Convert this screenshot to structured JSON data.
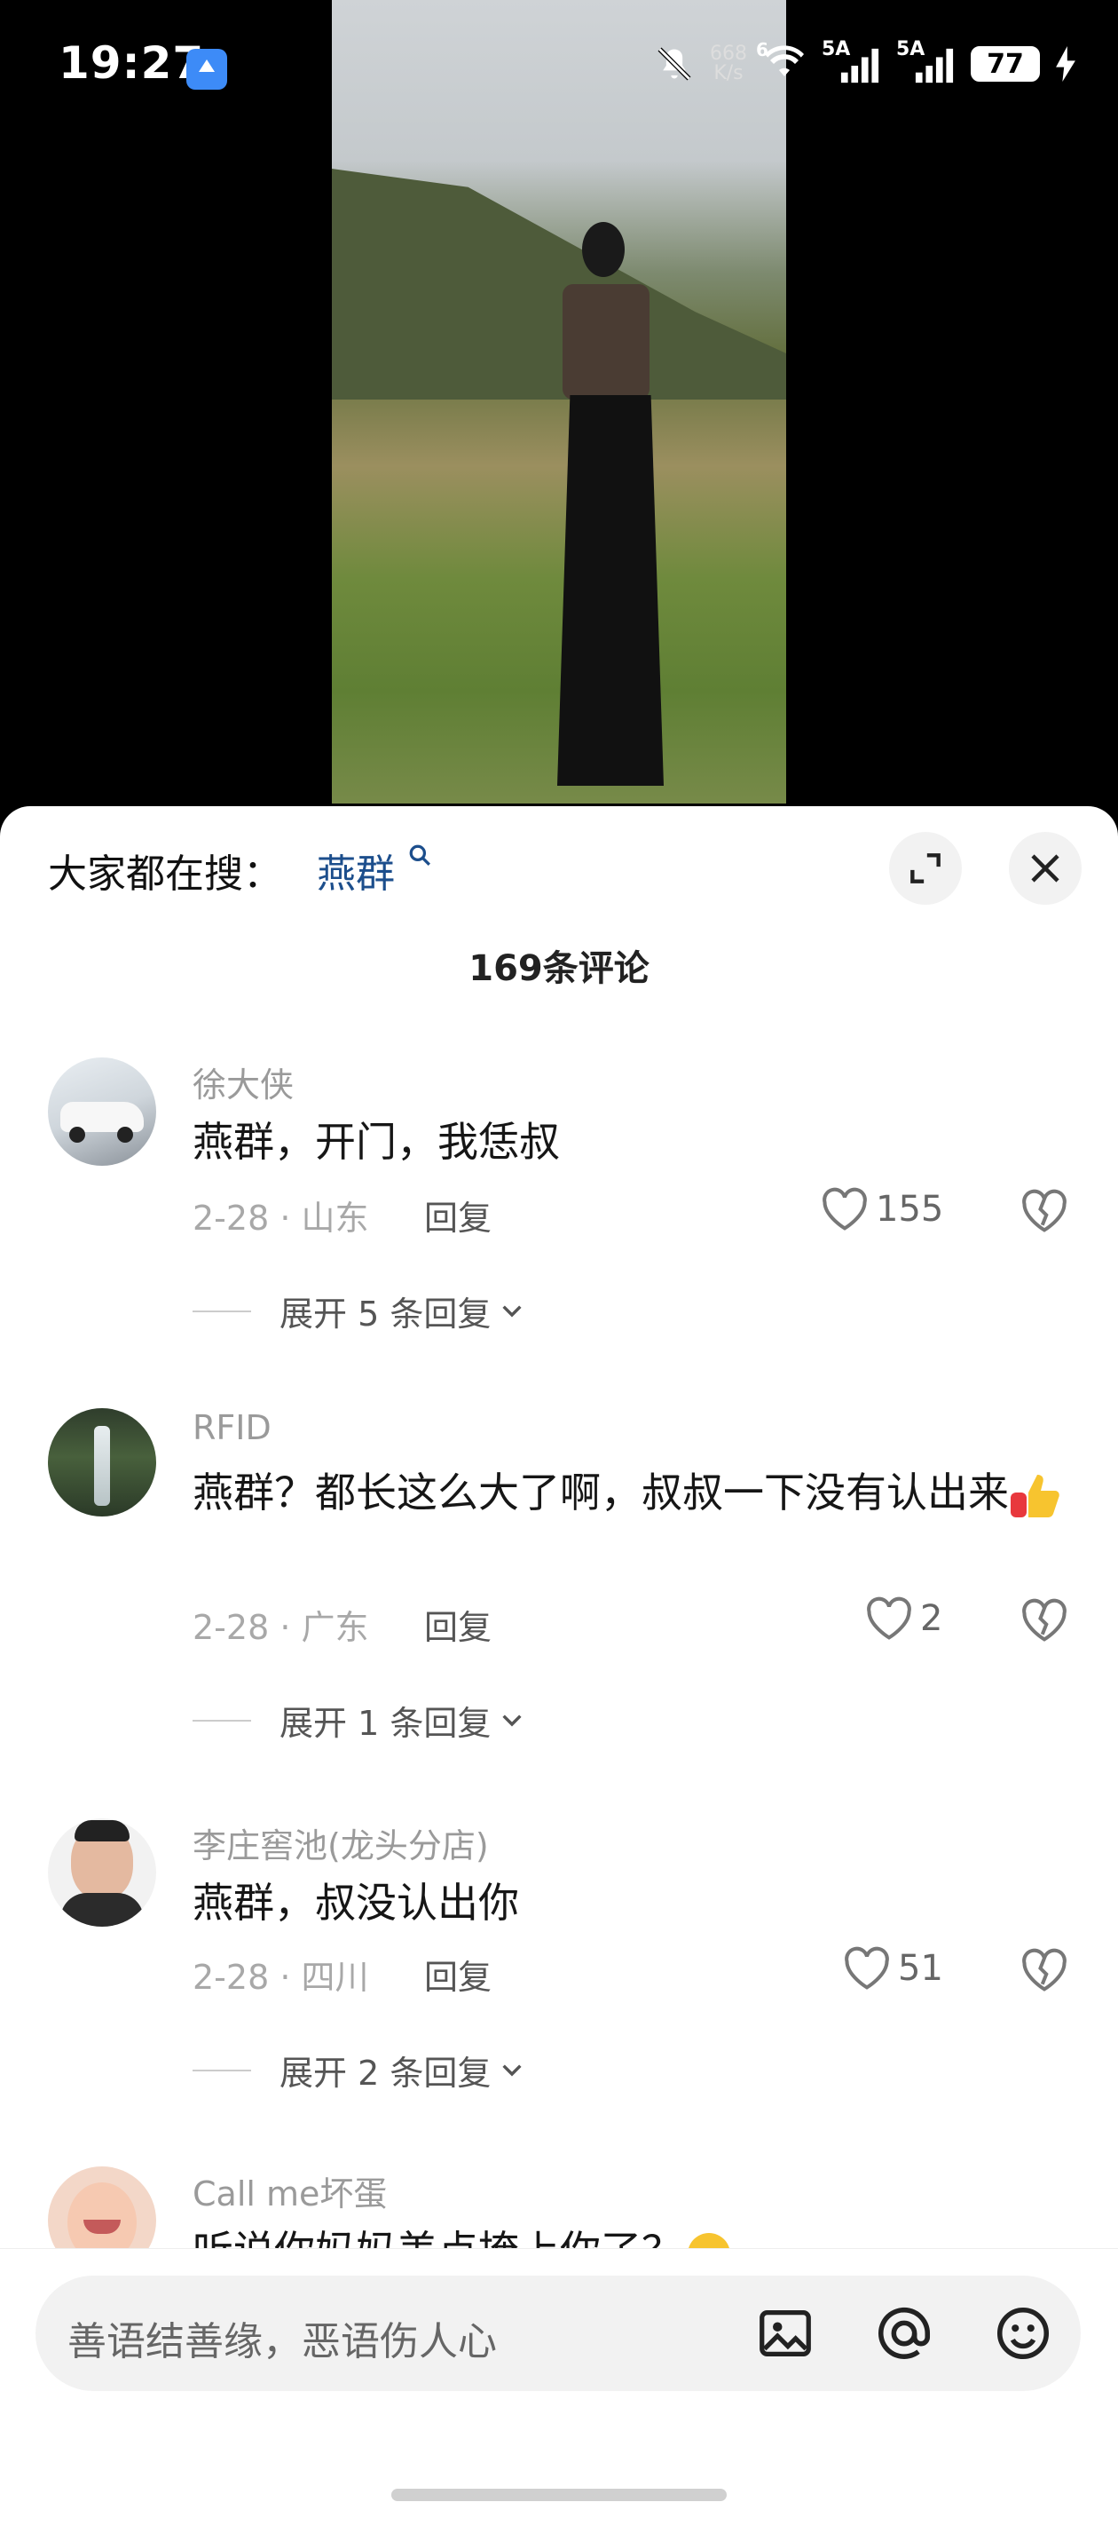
{
  "status_bar": {
    "time": "19:27",
    "net_speed_value": "668",
    "net_speed_unit": "K/s",
    "wifi_label": "6",
    "sim1_label": "5A",
    "sim2_label": "5A",
    "battery": "77"
  },
  "search": {
    "prefix": "大家都在搜：",
    "term": "燕群"
  },
  "comment_count": "169条评论",
  "comments": [
    {
      "user": "徐大侠",
      "text": "燕群，开门，我恁叔",
      "meta": "2-28 · 山东",
      "reply_label": "回复",
      "likes": "155",
      "expand": "展开 5 条回复"
    },
    {
      "user": "RFID",
      "text": "燕群？都长这么大了啊，叔叔一下没有认出来",
      "meta": "2-28 · 广东",
      "reply_label": "回复",
      "likes": "2",
      "expand": "展开 1 条回复"
    },
    {
      "user": "李庄窖池(龙头分店)",
      "text": "燕群，叔没认出你",
      "meta": "2-28 · 四川",
      "reply_label": "回复",
      "likes": "51",
      "expand": "展开 2 条回复"
    },
    {
      "user": "Call me坏蛋",
      "text": "听说你妈妈美点掩上你了？"
    }
  ],
  "input": {
    "placeholder": "善语结善缘，恶语伤人心"
  },
  "icons": {
    "expand": "expand-icon",
    "close": "close-icon",
    "like": "heart-icon",
    "dislike": "broken-heart-icon",
    "image": "image-icon",
    "mention": "at-icon",
    "emoji": "smiley-icon"
  }
}
